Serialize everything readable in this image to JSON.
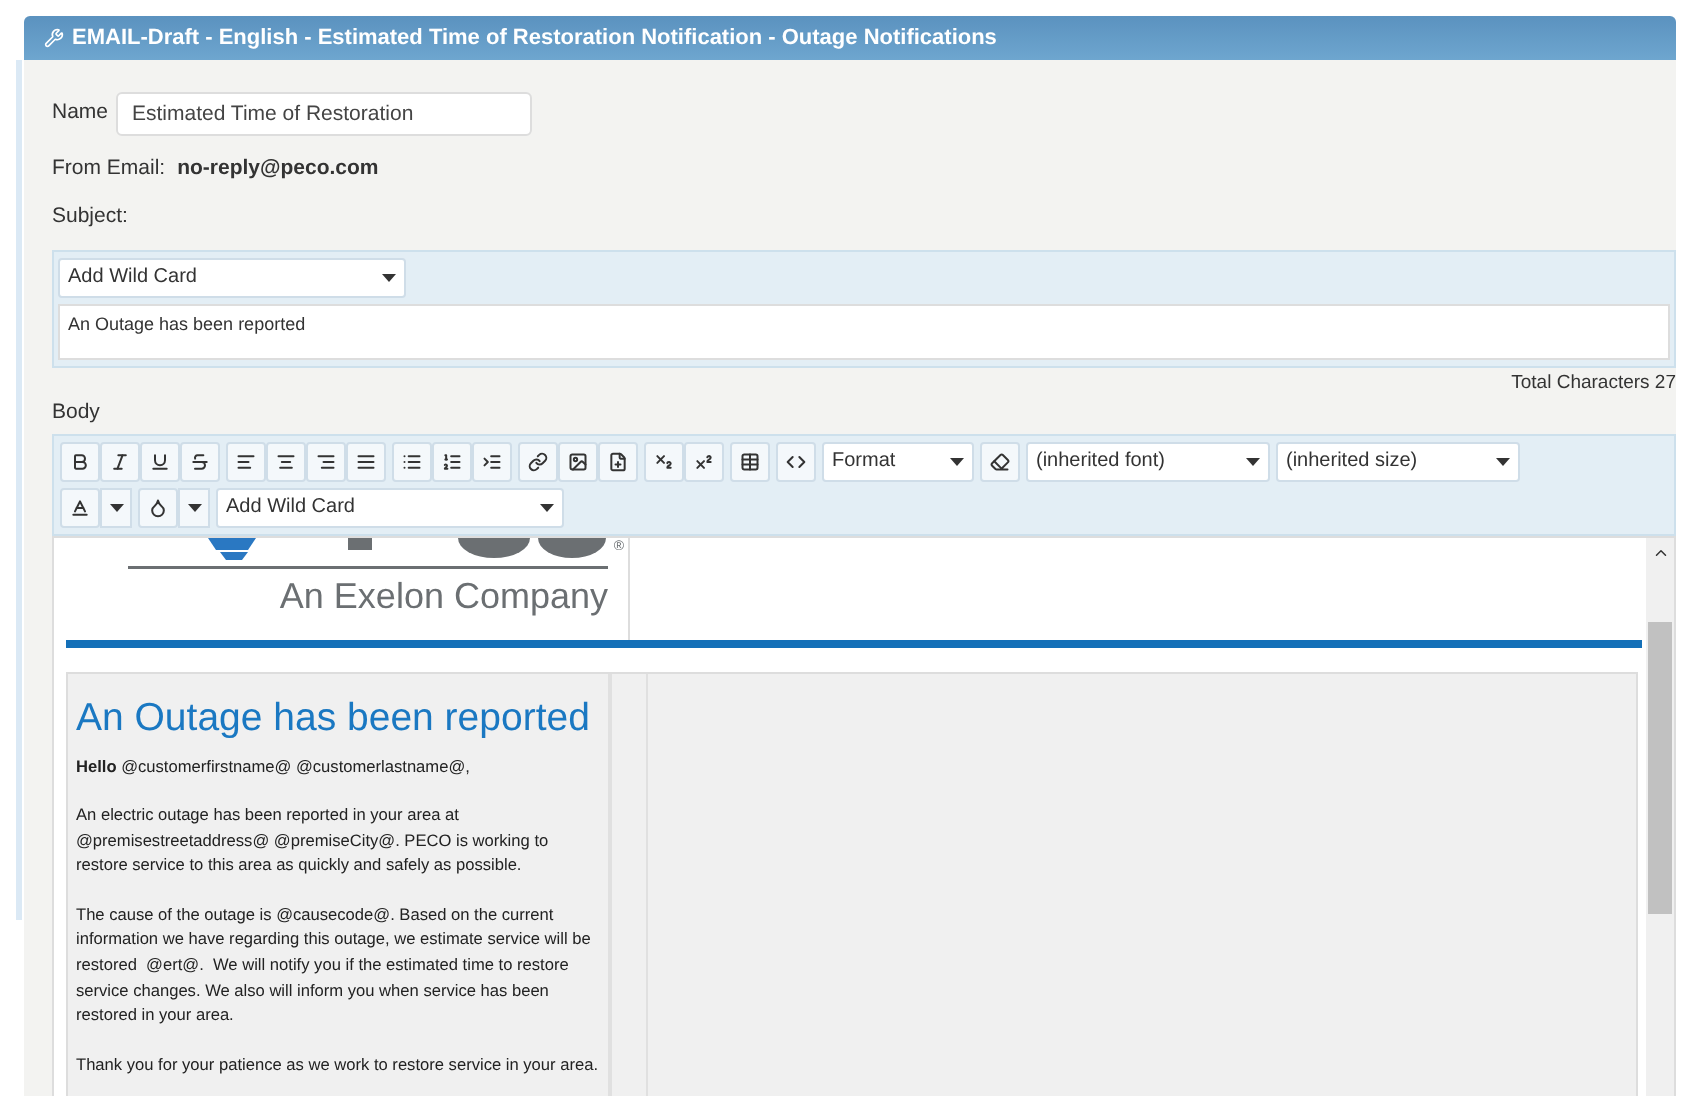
{
  "title": "EMAIL-Draft - English - Estimated Time of Restoration Notification - Outage Notifications",
  "name": {
    "label": "Name",
    "value": "Estimated Time of Restoration"
  },
  "from_email": {
    "label": "From Email:",
    "value": "no-reply@peco.com"
  },
  "subject": {
    "label": "Subject:",
    "wildcard": "Add Wild Card",
    "value": "An Outage has been reported"
  },
  "total_characters": "Total Characters 27",
  "body": {
    "label": "Body",
    "toolbar": {
      "format": "Format",
      "font": "(inherited font)",
      "size": "(inherited size)",
      "wildcard": "Add Wild Card"
    },
    "content": {
      "trademark": "®",
      "tagline": "An Exelon Company",
      "heading": "An Outage has been reported",
      "greeting": "**Hello** @customerfirstname@ @customerlastname@,",
      "paragraphs": [
        "An electric outage has been reported in your area at @premisestreetaddress@ @premiseCity@. PECO is working to restore service to this area as quickly and safely as possible.",
        "The cause of the outage is @causecode@. Based on the current information we have regarding this outage, we estimate service will be restored  @ert@.  We will notify you if the estimated time to restore service changes. We also will inform you when service has been restored in your area.",
        "Thank you for your patience as we work to restore service in your area."
      ]
    }
  }
}
